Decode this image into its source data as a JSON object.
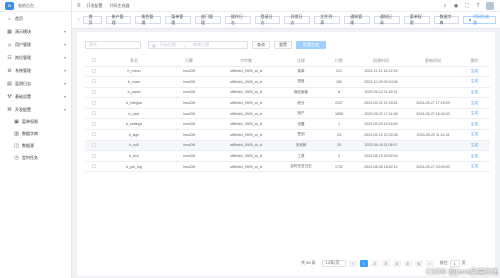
{
  "app": {
    "logo_mark": "G",
    "logo_text": "若依后台"
  },
  "sidebar": {
    "items": [
      {
        "label": "首页",
        "icon": "home-icon",
        "glyph": "⌂",
        "expandable": false
      },
      {
        "label": "演示模块",
        "icon": "component-icon",
        "glyph": "▦",
        "expandable": true
      },
      {
        "label": "用户管理",
        "icon": "user-icon",
        "glyph": "☺",
        "expandable": true
      },
      {
        "label": "岗位管理",
        "icon": "post-icon",
        "glyph": "☷",
        "expandable": true
      },
      {
        "label": "系统管理",
        "icon": "system-icon",
        "glyph": "⚙",
        "expandable": true
      },
      {
        "label": "监测日志",
        "icon": "log-icon",
        "glyph": "▤",
        "expandable": true
      },
      {
        "label": "基础设置",
        "icon": "settings-icon",
        "glyph": "⚒",
        "expandable": true
      },
      {
        "label": "开发配置",
        "icon": "dev-icon",
        "glyph": "⌘",
        "expandable": true
      }
    ],
    "subitems": [
      {
        "label": "菜单权限",
        "icon": "menu-icon",
        "glyph": "▣"
      },
      {
        "label": "数据字典",
        "icon": "dict-icon",
        "glyph": "▥"
      },
      {
        "label": "数据源",
        "icon": "datasource-icon",
        "glyph": "◫"
      },
      {
        "label": "定时任务",
        "icon": "job-icon",
        "glyph": "◷"
      }
    ]
  },
  "header": {
    "breadcrumb": [
      "开发配置",
      "代码生成器"
    ]
  },
  "tags": [
    {
      "label": "首页",
      "active": false
    },
    {
      "label": "账户管理",
      "active": false
    },
    {
      "label": "角色管理",
      "active": false
    },
    {
      "label": "菜单管理",
      "active": false
    },
    {
      "label": "部门管理",
      "active": false
    },
    {
      "label": "操作日志",
      "active": false
    },
    {
      "label": "登录日志",
      "active": false
    },
    {
      "label": "异常日志",
      "active": false
    },
    {
      "label": "文件列表",
      "active": false
    },
    {
      "label": "通知管理",
      "active": false
    },
    {
      "label": "通知记录",
      "active": false
    },
    {
      "label": "菜单权限",
      "active": false
    },
    {
      "label": "数据字典",
      "active": false
    },
    {
      "label": "代码生成器",
      "active": true
    }
  ],
  "search": {
    "table_placeholder": "表名",
    "date_start_placeholder": "开始日期",
    "date_end_placeholder": "结束日期",
    "search_label": "查询",
    "reset_label": "重置",
    "generate_label": "批量生成"
  },
  "table": {
    "columns": [
      "表名",
      "引擎",
      "字符集",
      "注释",
      "行数",
      "创建时间",
      "更新时间",
      "操作"
    ],
    "rows": [
      [
        "b_menu",
        "InnoDB",
        "utf8mb4_0900_ai_ci",
        "菜单",
        "221",
        "2023-11-14 16:12:15",
        "",
        "生成"
      ],
      [
        "b_voice",
        "InnoDB",
        "utf8mb4_0900_ai_ci",
        "语音",
        "180",
        "2023-10-09 09:24:08",
        "",
        "生成"
      ],
      [
        "b_panel",
        "InnoDB",
        "utf8mb4_0900_ai_ci",
        "商品面板",
        "8",
        "2023-09-12 11:45:31",
        "",
        "生成"
      ],
      [
        "b_integral",
        "InnoDB",
        "utf8mb4_0900_ai_ci",
        "积分",
        "2137",
        "2023-09-22 21:15:21",
        "2024-05-27 17:15:09",
        "生成"
      ],
      [
        "b_user",
        "InnoDB",
        "utf8mb4_0900_ai_ci",
        "用户",
        "1658",
        "2023-09-22 17:11:06",
        "2024-05-27 16:42:40",
        "生成"
      ],
      [
        "b_settings",
        "InnoDB",
        "utf8mb4_0900_ai_ci",
        "设置",
        "1",
        "2023-09-20 15:16:59",
        "",
        "生成"
      ],
      [
        "b_sign",
        "InnoDB",
        "utf8mb4_0900_ai_ci",
        "签到",
        "23",
        "2023-09-12 23:32:36",
        "2024-05-22 11:11:15",
        "生成"
      ],
      [
        "b_wifi",
        "InnoDB",
        "utf8mb4_0900_ai_ci",
        "无线网",
        "25",
        "2023-08-18 11:08:57",
        "",
        "生成"
      ],
      [
        "b_tool",
        "InnoDB",
        "utf8mb4_0900_ai_ci",
        "工具",
        "3",
        "2023-08-15 20:52:04",
        "",
        "生成"
      ],
      [
        "b_job_log",
        "InnoDB",
        "utf8mb4_0900_ai_ci",
        "定时任务日志",
        "1722",
        "2023-08-05 18:52:14",
        "2024-05-27 20:00:00",
        "生成"
      ]
    ],
    "highlight_row": 7
  },
  "pagination": {
    "total": "共 56 条",
    "page_size": "10条/页",
    "pages": [
      "1",
      "2",
      "3",
      "4",
      "5",
      "6"
    ],
    "current_page": "1",
    "prev": "‹",
    "next": "›",
    "goto_label": "前往",
    "goto_value": "1",
    "goto_suffix": "页"
  },
  "watermark": "CSDN @Java后端修炼"
}
